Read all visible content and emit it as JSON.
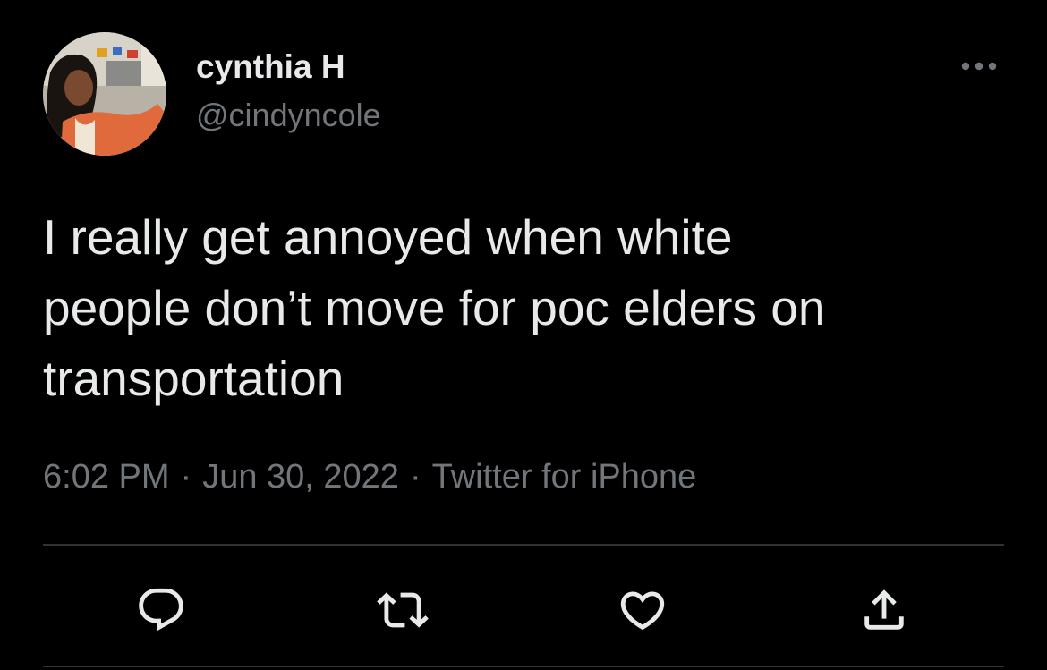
{
  "user": {
    "display_name": "cynthia H",
    "handle": "@cindyncole"
  },
  "tweet": {
    "text_lines": [
      "I really get annoyed when white",
      "people don’t move for poc elders on",
      "transportation"
    ],
    "time": "6:02 PM",
    "separator": "·",
    "date": "Jun 30, 2022",
    "source": "Twitter for iPhone"
  },
  "actions": {
    "reply_icon": "reply-icon",
    "retweet_icon": "retweet-icon",
    "like_icon": "heart-icon",
    "share_icon": "share-icon",
    "more_icon": "more-options-icon"
  },
  "colors": {
    "background": "#000000",
    "primary_text": "#e7e9ea",
    "secondary_text": "#71767b",
    "divider": "#2f3336"
  }
}
